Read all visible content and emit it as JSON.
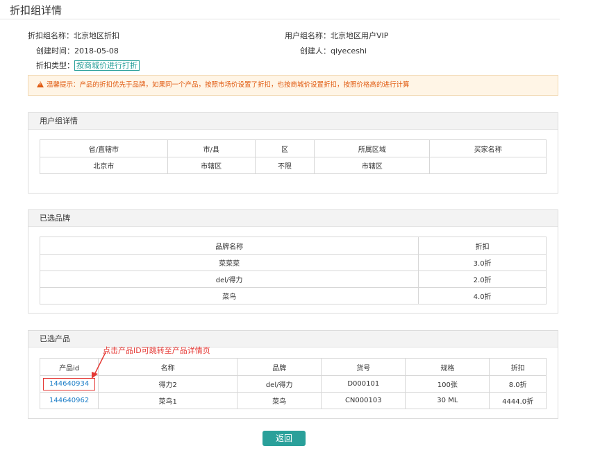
{
  "page": {
    "title": "折扣组详情"
  },
  "info": {
    "group_name_label": "折扣组名称：",
    "group_name": "北京地区折扣",
    "created_time_label": "创建时间：",
    "created_time": "2018-05-08",
    "discount_type_label": "折扣类型：",
    "discount_type": "按商城价进行打折",
    "user_group_label": "用户组名称：",
    "user_group": "北京地区用户VIP",
    "creator_label": "创建人：",
    "creator": "qiyeceshi"
  },
  "warning": {
    "text": "温馨提示：产品的折扣优先于品牌，如果同一个产品，按照市场价设置了折扣，也按商城价设置折扣，按照价格高的进行计算"
  },
  "user_group_panel": {
    "title": "用户组详情",
    "headers": [
      "省/直辖市",
      "市/县",
      "区",
      "所属区域",
      "买家名称"
    ],
    "rows": [
      [
        "北京市",
        "市辖区",
        "不限",
        "市辖区",
        ""
      ]
    ]
  },
  "brand_panel": {
    "title": "已选品牌",
    "headers": [
      "品牌名称",
      "折扣"
    ],
    "rows": [
      [
        "菜菜菜",
        "3.0折"
      ],
      [
        "del/得力",
        "2.0折"
      ],
      [
        "菜鸟",
        "4.0折"
      ]
    ]
  },
  "product_panel": {
    "title": "已选产品",
    "headers": [
      "产品id",
      "名称",
      "品牌",
      "货号",
      "规格",
      "折扣"
    ],
    "rows": [
      [
        "144640934",
        "得力2",
        "del/得力",
        "D000101",
        "100张",
        "8.0折"
      ],
      [
        "144640962",
        "菜鸟1",
        "菜鸟",
        "CN000103",
        "30 ML",
        "4444.0折"
      ]
    ]
  },
  "annotation": {
    "text": "点击产品ID可跳转至产品详情页",
    "color": "#e53935"
  },
  "actions": {
    "back_label": "返回"
  },
  "colors": {
    "accent": "#2aa09a",
    "link": "#1e7fc8",
    "warning": "#e05a10"
  }
}
